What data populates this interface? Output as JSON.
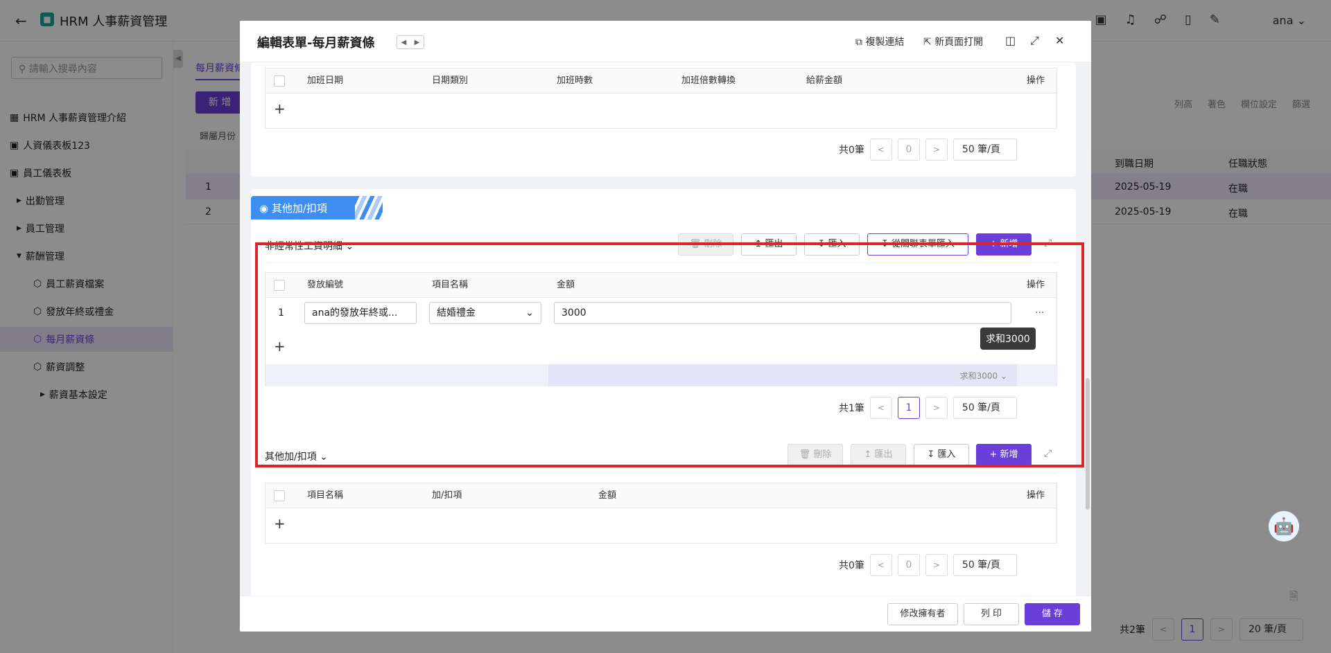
{
  "topbar": {
    "app_title": "HRM 人事薪資管理",
    "user": "ana"
  },
  "sidebar": {
    "search_placeholder": "請輸入搜尋內容",
    "items": [
      {
        "label": "HRM 人事薪資管理介紹"
      },
      {
        "label": "人資儀表板123"
      },
      {
        "label": "員工儀表板"
      },
      {
        "label": "出勤管理"
      },
      {
        "label": "員工管理"
      },
      {
        "label": "薪酬管理"
      },
      {
        "label": "員工薪資檔案"
      },
      {
        "label": "發放年終或禮金"
      },
      {
        "label": "每月薪資條"
      },
      {
        "label": "薪資調整"
      },
      {
        "label": "薪資基本設定"
      }
    ]
  },
  "background": {
    "tab": "每月薪資條",
    "add_button": "新 增",
    "group_label": "歸屬月份",
    "tools": [
      "列高",
      "著色",
      "欄位設定",
      "篩選"
    ],
    "col_hire_date": "到職日期",
    "col_status": "任職狀態",
    "rows": [
      {
        "num": "1",
        "hire_date": "2025-05-19",
        "status": "在職"
      },
      {
        "num": "2",
        "hire_date": "2025-05-19",
        "status": "在職"
      }
    ],
    "pager_total": "共2筆",
    "pager_page": "1",
    "pager_size": "20 筆/頁"
  },
  "modal": {
    "title": "編輯表單-每月薪資條",
    "copy_link": "複製連結",
    "open_new": "新頁面打開",
    "overtime_table": {
      "headers": [
        "加班日期",
        "日期類別",
        "加班時數",
        "加班倍數轉換",
        "給薪金額"
      ],
      "op": "操作",
      "total": "共0筆",
      "page": "0",
      "page_size": "50 筆/頁"
    },
    "section_tab": "其他加/扣項",
    "irregular": {
      "title": "非經常性工資明細",
      "delete": "刪除",
      "export": "匯出",
      "import": "匯入",
      "import_related": "從關聯表單匯入",
      "add": "新增",
      "headers": [
        "發放編號",
        "項目名稱",
        "金額"
      ],
      "op": "操作",
      "row": {
        "num": "1",
        "issue_no": "ana的發放年終或...",
        "item": "結婚禮金",
        "amount": "3000",
        "more": "···"
      },
      "tooltip": "求和3000",
      "sum": "求和3000",
      "total": "共1筆",
      "page": "1",
      "page_size": "50 筆/頁"
    },
    "other": {
      "title": "其他加/扣項",
      "delete": "刪除",
      "export": "匯出",
      "import": "匯入",
      "add": "新增",
      "headers": [
        "項目名稱",
        "加/扣項",
        "金額"
      ],
      "op": "操作",
      "total": "共0筆",
      "page": "0",
      "page_size": "50 筆/頁"
    },
    "footer": {
      "change_owner": "修改擁有者",
      "print": "列 印",
      "save": "儲 存"
    }
  }
}
